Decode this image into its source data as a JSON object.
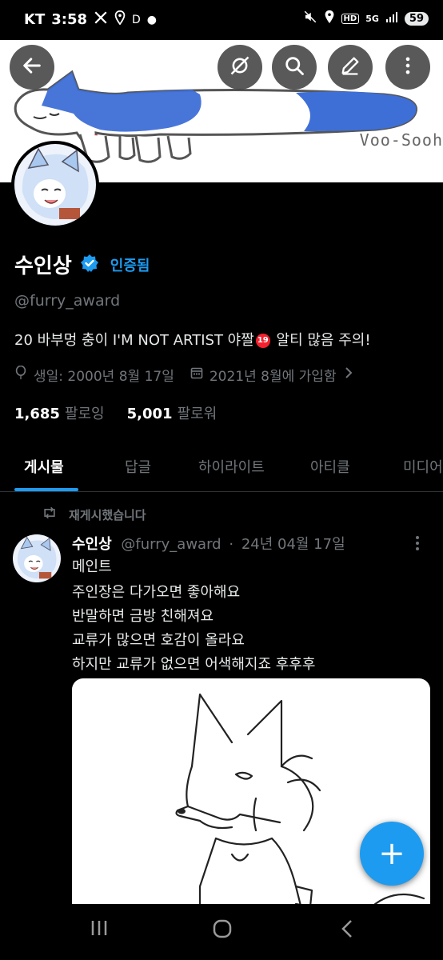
{
  "status": {
    "carrier": "KT",
    "time": "3:58",
    "notif_icons": [
      "x-icon",
      "location-icon"
    ],
    "d_label": "D",
    "battery": "59",
    "hd_label": "HD",
    "net_label": "5G"
  },
  "banner": {
    "signature": "Voo-Sooh"
  },
  "profile": {
    "name": "수인상",
    "verified_label": "인증됨",
    "handle": "@furry_award",
    "bio_pre": "20 바부멍 충이   I'M NOT ARTIST 야짤",
    "bio_badge": "19",
    "bio_post": " 알티 많음 주의!",
    "birthday": "생일: 2000년 8월 17일",
    "joined": "2021년 8월에 가입함",
    "following_count": "1,685",
    "following_label": "팔로잉",
    "followers_count": "5,001",
    "followers_label": "팔로워"
  },
  "tabs": [
    {
      "label": "게시물",
      "active": true
    },
    {
      "label": "답글"
    },
    {
      "label": "하이라이트"
    },
    {
      "label": "아티클"
    },
    {
      "label": "미디어"
    }
  ],
  "post": {
    "repost_label": "재게시했습니다",
    "author_name": "수인상",
    "author_handle": "@furry_award",
    "date": "24년 04월 17일",
    "separator": "·",
    "lines": [
      "메인트",
      "주인장은 다가오면 좋아해요",
      "반말하면 금방 친해져요",
      "교류가 많으면 호감이 올라요",
      "하지만 교류가 없으면 어색해지죠 후후후"
    ]
  },
  "fab": {
    "label": "+"
  },
  "colors": {
    "accent": "#1d9bf0",
    "background": "#000000",
    "secondary_text": "#71767b",
    "verified_badge": "#1d9bf0",
    "age_badge": "#f4212e"
  }
}
